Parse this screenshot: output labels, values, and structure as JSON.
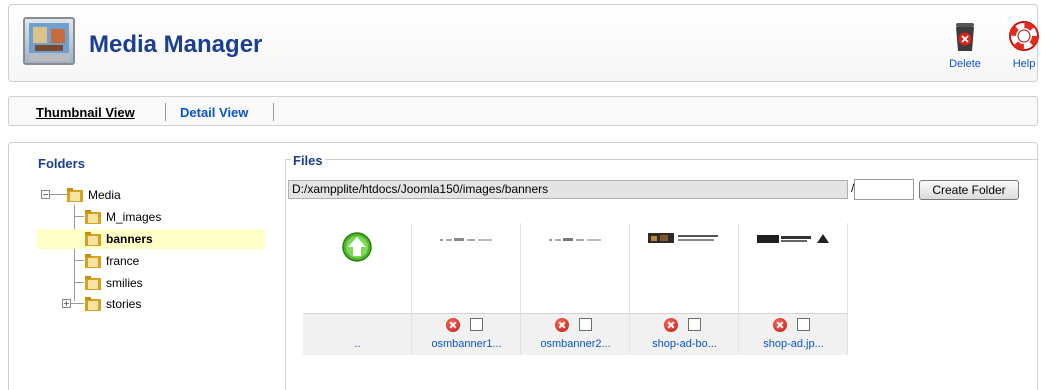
{
  "header": {
    "title": "Media Manager",
    "logo_icon": "media-manager-icon",
    "delete_label": "Delete",
    "help_label": "Help",
    "delete_icon": "trash-delete-icon",
    "help_icon": "lifebuoy-help-icon"
  },
  "tabs": [
    {
      "label": "Thumbnail View",
      "active": true
    },
    {
      "label": "Detail View",
      "active": false
    }
  ],
  "folders": {
    "title": "Folders",
    "tree": [
      {
        "label": "Media",
        "level": 0,
        "expander": "minus"
      },
      {
        "label": "M_images",
        "level": 1
      },
      {
        "label": "banners",
        "level": 1,
        "selected": true
      },
      {
        "label": "france",
        "level": 1
      },
      {
        "label": "smilies",
        "level": 1
      },
      {
        "label": "stories",
        "level": 1,
        "expander": "plus"
      }
    ]
  },
  "files": {
    "legend": "Files",
    "path": "D:/xampplite/htdocs/Joomla150/images/banners",
    "path_separator": "/",
    "new_folder_value": "",
    "create_folder_label": "Create Folder",
    "items": [
      {
        "name": "..",
        "type": "up",
        "icon": "folder-up-arrow-icon"
      },
      {
        "name": "osmbanner1...",
        "type": "image"
      },
      {
        "name": "osmbanner2...",
        "type": "image"
      },
      {
        "name": "shop-ad-bo...",
        "type": "image"
      },
      {
        "name": "shop-ad.jp...",
        "type": "image"
      }
    ]
  },
  "colors": {
    "title": "#1c3f8f",
    "link": "#0b55c4",
    "selected_row": "#ffffc8"
  }
}
